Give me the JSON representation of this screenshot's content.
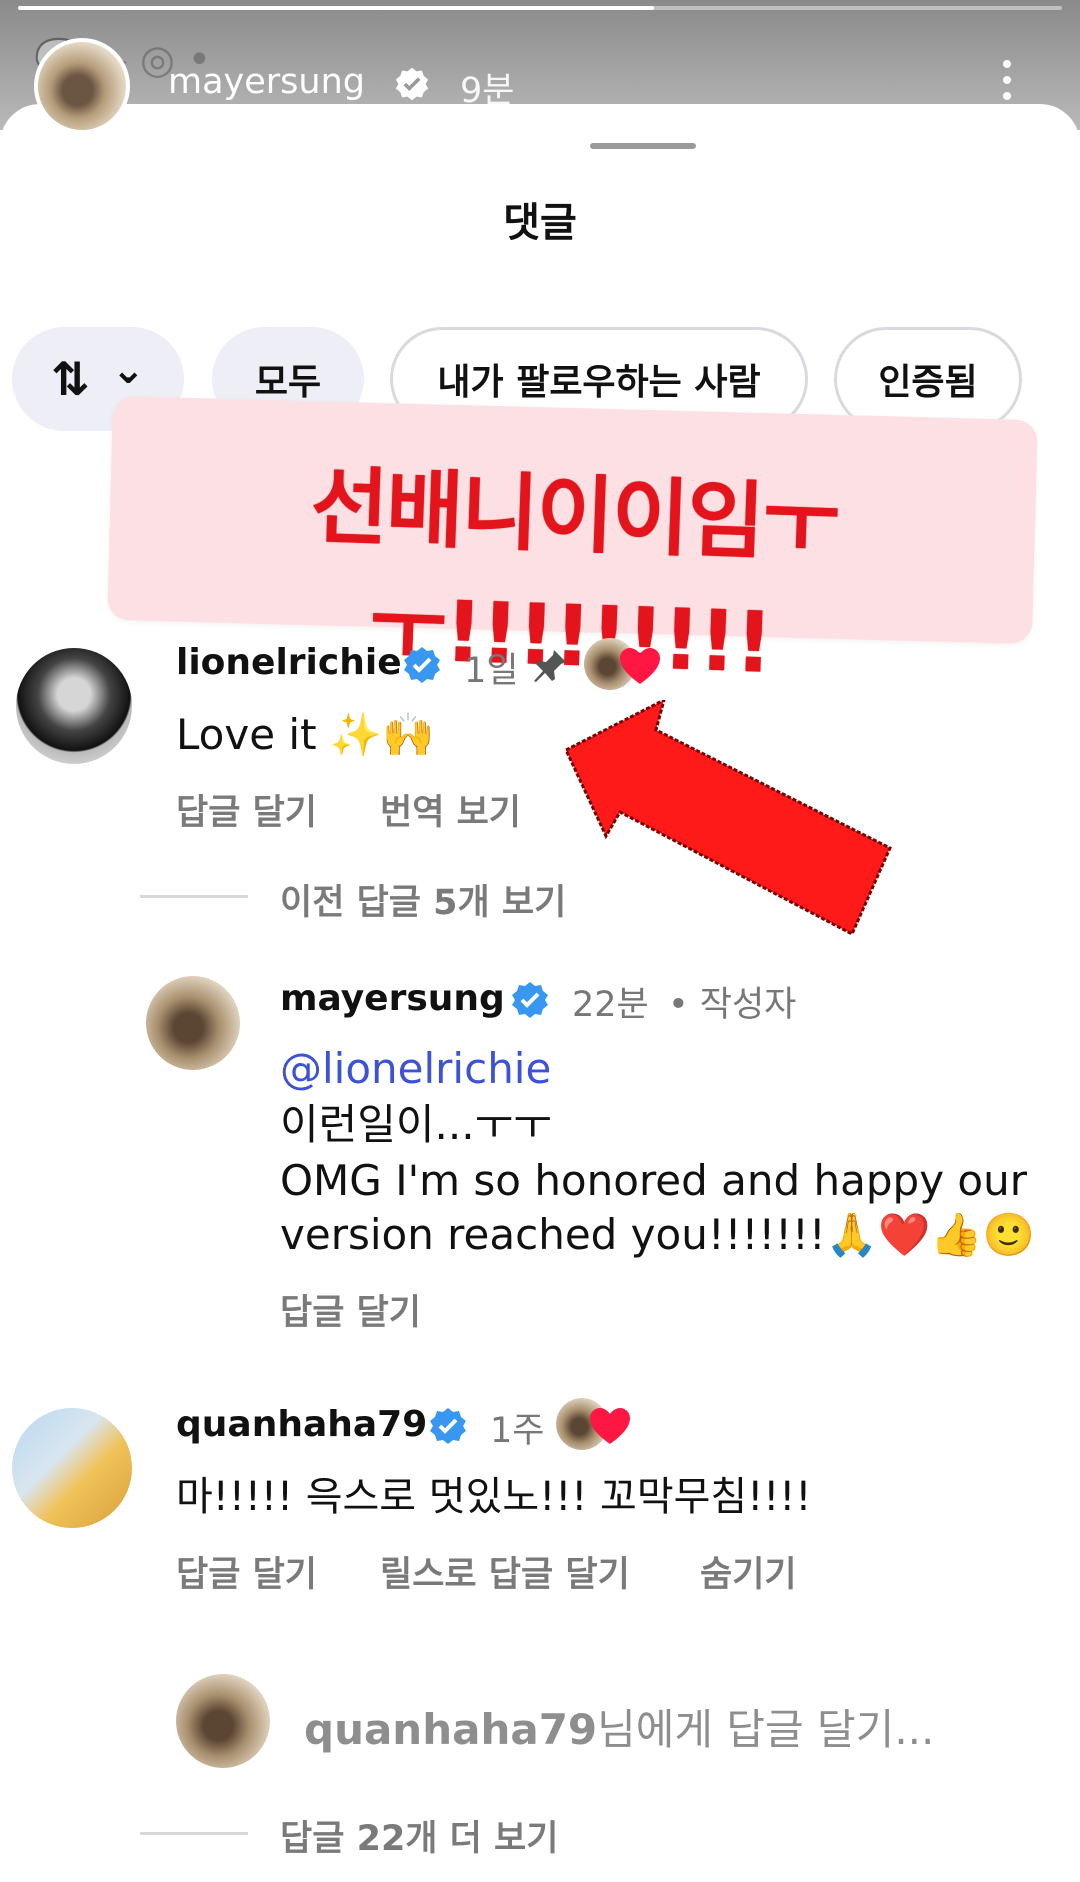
{
  "story": {
    "username": "mayersung",
    "time": "9분",
    "ghost_icons": "💬 ▶ ◎ •"
  },
  "sheet": {
    "title": "댓글"
  },
  "filters": {
    "sort_icon": "⇅",
    "sort_chevron": "⌄",
    "chips": [
      "모두",
      "내가 팔로우하는 사람",
      "인증됨"
    ]
  },
  "annotation": {
    "text": "선배니이이임ㅜㅜ!!!!!!!!!"
  },
  "comments": [
    {
      "username": "lionelrichie",
      "time": "1일",
      "text": "Love it ✨🙌",
      "actions": [
        "답글 달기",
        "번역 보기"
      ],
      "view_previous": "이전 답글 5개 보기"
    },
    {
      "username": "mayersung",
      "time": "22분",
      "author_tag": "• 작성자",
      "mention": "@lionelrichie",
      "lines": [
        "이런일이...ㅜㅜ",
        "OMG I'm so honored and happy our",
        "version reached you!!!!!!!🙏❤️👍🙂"
      ],
      "actions": [
        "답글 달기"
      ]
    },
    {
      "username": "quanhaha79",
      "time": "1주",
      "text": "마!!!!! 윽스로 멋있노!!! 꼬막무침!!!!",
      "actions": [
        "답글 달기",
        "릴스로 답글 달기",
        "숨기기"
      ]
    }
  ],
  "reply_input": {
    "user": "quanhaha79",
    "suffix": "님에게 답글 달기..."
  },
  "more_replies": "답글 22개 더 보기",
  "colors": {
    "verified_blue": "#3897f0",
    "heart_red": "#ff1744",
    "annotation_red": "#e3141b",
    "annotation_bg": "#fde0e3",
    "mention_blue": "#3e52d8"
  },
  "icons": {
    "verified": "verified-badge-icon",
    "pin": "pin-icon",
    "heart": "heart-icon",
    "sort": "sort-icon",
    "menu": "more-vertical-icon",
    "arrow": "red-arrow-annotation"
  }
}
